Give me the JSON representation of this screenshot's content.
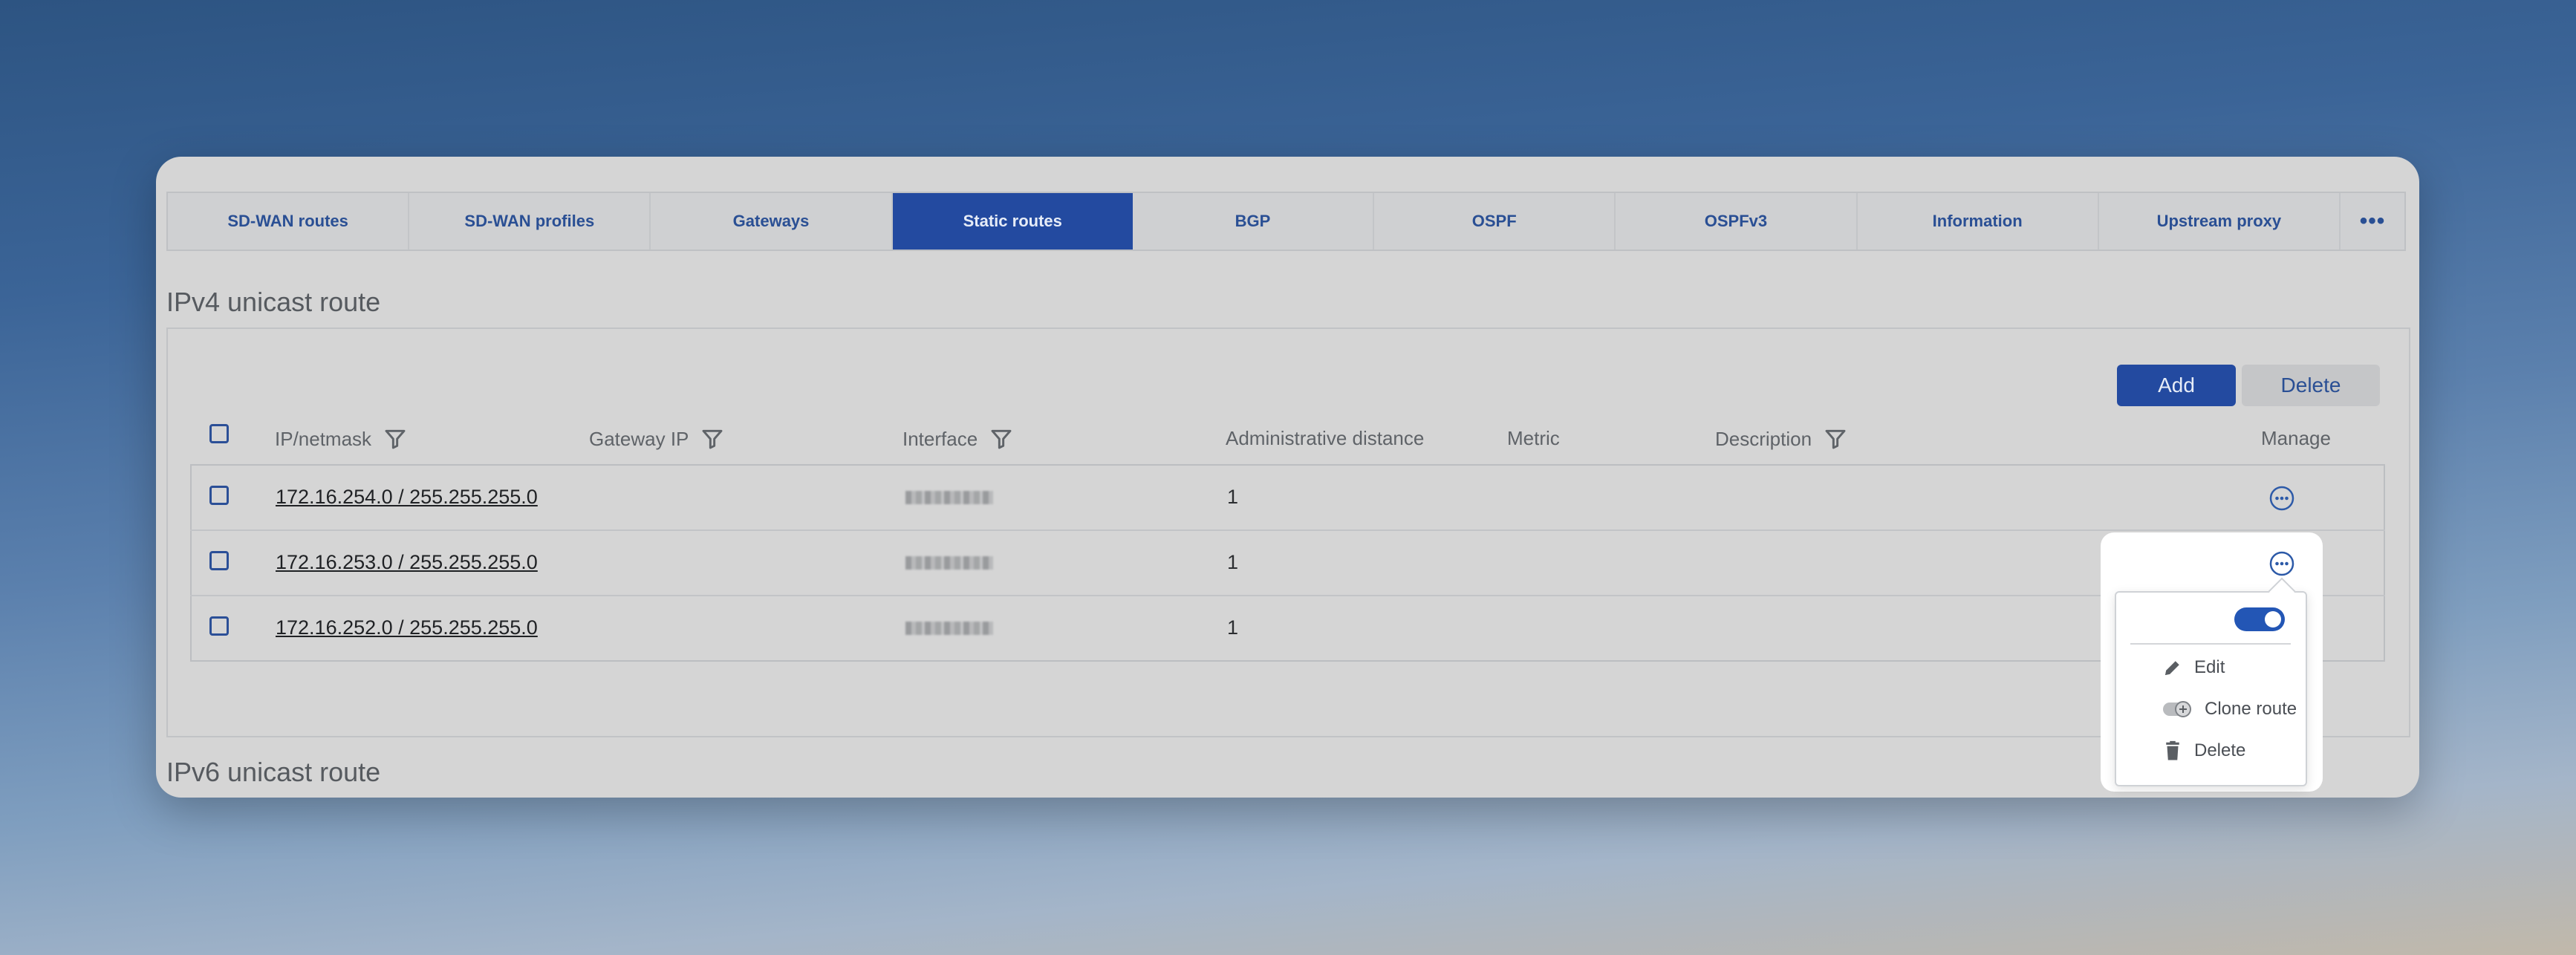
{
  "tabs": [
    {
      "label": "SD-WAN routes"
    },
    {
      "label": "SD-WAN profiles"
    },
    {
      "label": "Gateways"
    },
    {
      "label": "Static routes",
      "active": true
    },
    {
      "label": "BGP"
    },
    {
      "label": "OSPF"
    },
    {
      "label": "OSPFv3"
    },
    {
      "label": "Information"
    },
    {
      "label": "Upstream proxy"
    }
  ],
  "more_tabs_label": "•••",
  "ipv4": {
    "title": "IPv4 unicast route",
    "add_label": "Add",
    "delete_label": "Delete",
    "columns": {
      "ip_netmask": "IP/netmask",
      "gateway_ip": "Gateway IP",
      "interface": "Interface",
      "admin_distance": "Administrative distance",
      "metric": "Metric",
      "description": "Description",
      "manage": "Manage"
    },
    "rows": [
      {
        "ip_netmask": "172.16.254.0 / 255.255.255.0",
        "gateway_ip": "",
        "interface": "(redacted)",
        "admin_distance": "1",
        "metric": "",
        "description": ""
      },
      {
        "ip_netmask": "172.16.253.0 / 255.255.255.0",
        "gateway_ip": "",
        "interface": "(redacted)",
        "admin_distance": "1",
        "metric": "",
        "description": ""
      },
      {
        "ip_netmask": "172.16.252.0 / 255.255.255.0",
        "gateway_ip": "",
        "interface": "(redacted)",
        "admin_distance": "1",
        "metric": "",
        "description": ""
      }
    ]
  },
  "ipv6": {
    "title": "IPv6 unicast route"
  },
  "manage_menu": {
    "toggle_on": true,
    "items": [
      {
        "label": "Edit",
        "icon": "pencil-icon"
      },
      {
        "label": "Clone route",
        "icon": "clone-icon"
      },
      {
        "label": "Delete",
        "icon": "trash-icon"
      }
    ]
  },
  "colors": {
    "accent": "#234aa0",
    "toggle": "#2356b5"
  }
}
